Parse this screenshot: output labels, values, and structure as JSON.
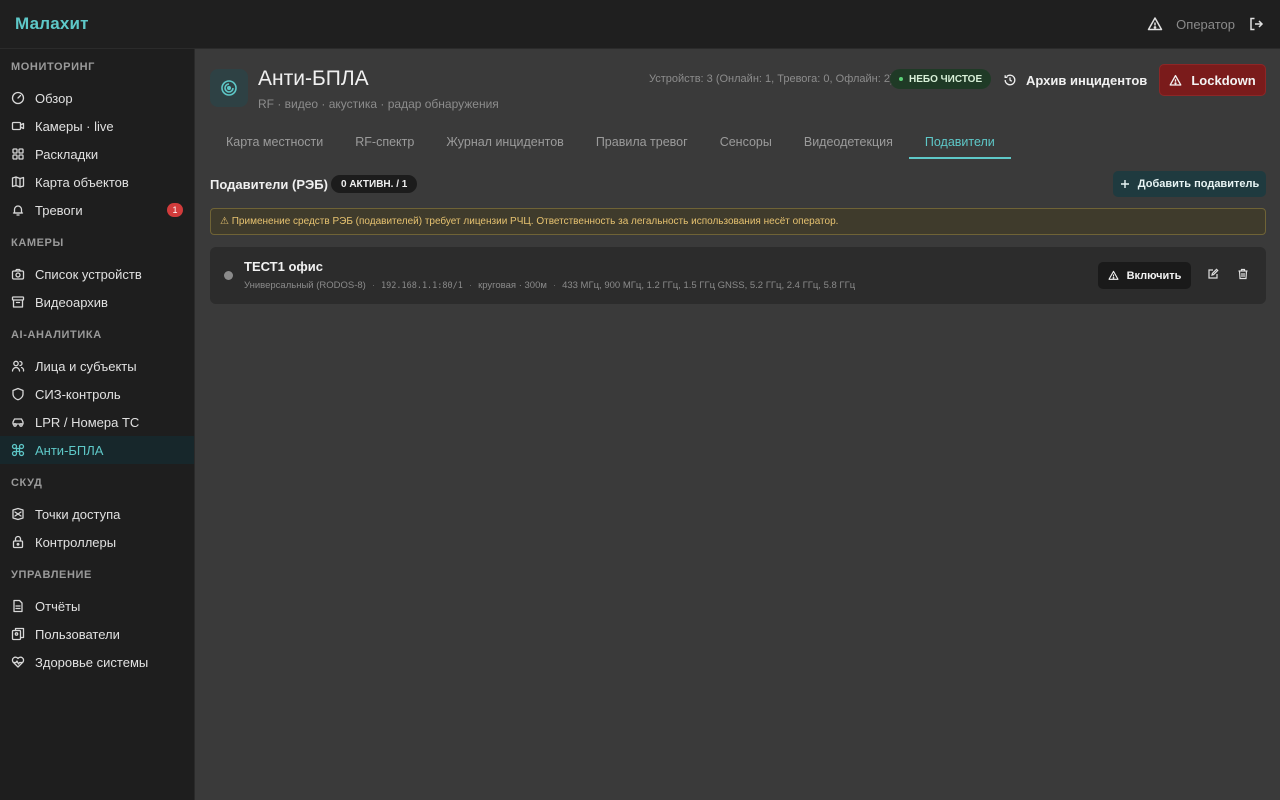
{
  "app": {
    "brand": "Малахит",
    "user_label": "Оператор"
  },
  "sidebar": {
    "sections": [
      {
        "title": "МОНИТОРИНГ",
        "items": [
          {
            "label": "Обзор",
            "icon": "gauge-icon"
          },
          {
            "label": "Камеры · live",
            "icon": "video-icon"
          },
          {
            "label": "Раскладки",
            "icon": "grid-icon"
          },
          {
            "label": "Карта объектов",
            "icon": "map-icon"
          },
          {
            "label": "Тревоги",
            "icon": "bell-icon",
            "badge": "1"
          }
        ]
      },
      {
        "title": "КАМЕРЫ",
        "items": [
          {
            "label": "Список устройств",
            "icon": "camera-icon"
          },
          {
            "label": "Видеоархив",
            "icon": "archive-icon"
          }
        ]
      },
      {
        "title": "AI-АНАЛИТИКА",
        "items": [
          {
            "label": "Лица и субъекты",
            "icon": "users-icon"
          },
          {
            "label": "СИЗ-контроль",
            "icon": "shield-icon"
          },
          {
            "label": "LPR / Номера ТС",
            "icon": "car-icon"
          },
          {
            "label": "Анти-БПЛА",
            "icon": "drone-icon",
            "active": true
          }
        ]
      },
      {
        "title": "СКУД",
        "items": [
          {
            "label": "Точки доступа",
            "icon": "door-icon"
          },
          {
            "label": "Контроллеры",
            "icon": "lock-icon"
          }
        ]
      },
      {
        "title": "УПРАВЛЕНИЕ",
        "items": [
          {
            "label": "Отчёты",
            "icon": "report-icon"
          },
          {
            "label": "Пользователи",
            "icon": "copy-users-icon"
          },
          {
            "label": "Здоровье системы",
            "icon": "heart-pulse-icon"
          }
        ]
      }
    ]
  },
  "header": {
    "title": "Анти-БПЛА",
    "subtitle": "RF · видео · акустика · радар обнаружения",
    "status": "Устройств: 3 (Онлайн: 1, Тревога: 0, Офлайн: 2)",
    "sky_badge": "НЕБО ЧИСТОЕ",
    "archive_label": "Архив инцидентов",
    "lockdown_label": "Lockdown"
  },
  "tabs": [
    {
      "label": "Карта местности"
    },
    {
      "label": "RF-спектр"
    },
    {
      "label": "Журнал инцидентов"
    },
    {
      "label": "Правила тревог"
    },
    {
      "label": "Сенсоры"
    },
    {
      "label": "Видеодетекция"
    },
    {
      "label": "Подавители",
      "active": true
    }
  ],
  "section": {
    "title": "Подавители (РЭБ)",
    "count": "0 АКТИВН. / 1",
    "add_label": "Добавить подавитель",
    "warning": "⚠ Применение средств РЭБ (подавителей) требует лицензии РЧЦ. Ответственность за легальность использования несёт оператор."
  },
  "devices": [
    {
      "name": "ТЕСТ1 офис",
      "model": "Универсальный (RODOS-8)",
      "address": "192.168.1.1:80/1",
      "pattern": "круговая · 300м",
      "bands": "433 МГц, 900 МГц, 1.2 ГГц, 1.5 ГГц GNSS, 5.2 ГГц, 2.4 ГГц, 5.8 ГГц",
      "enable_label": "Включить"
    }
  ],
  "colors": {
    "accent": "#5ec8c8",
    "danger": "#7a1b1b",
    "warning": "#e6c270"
  }
}
